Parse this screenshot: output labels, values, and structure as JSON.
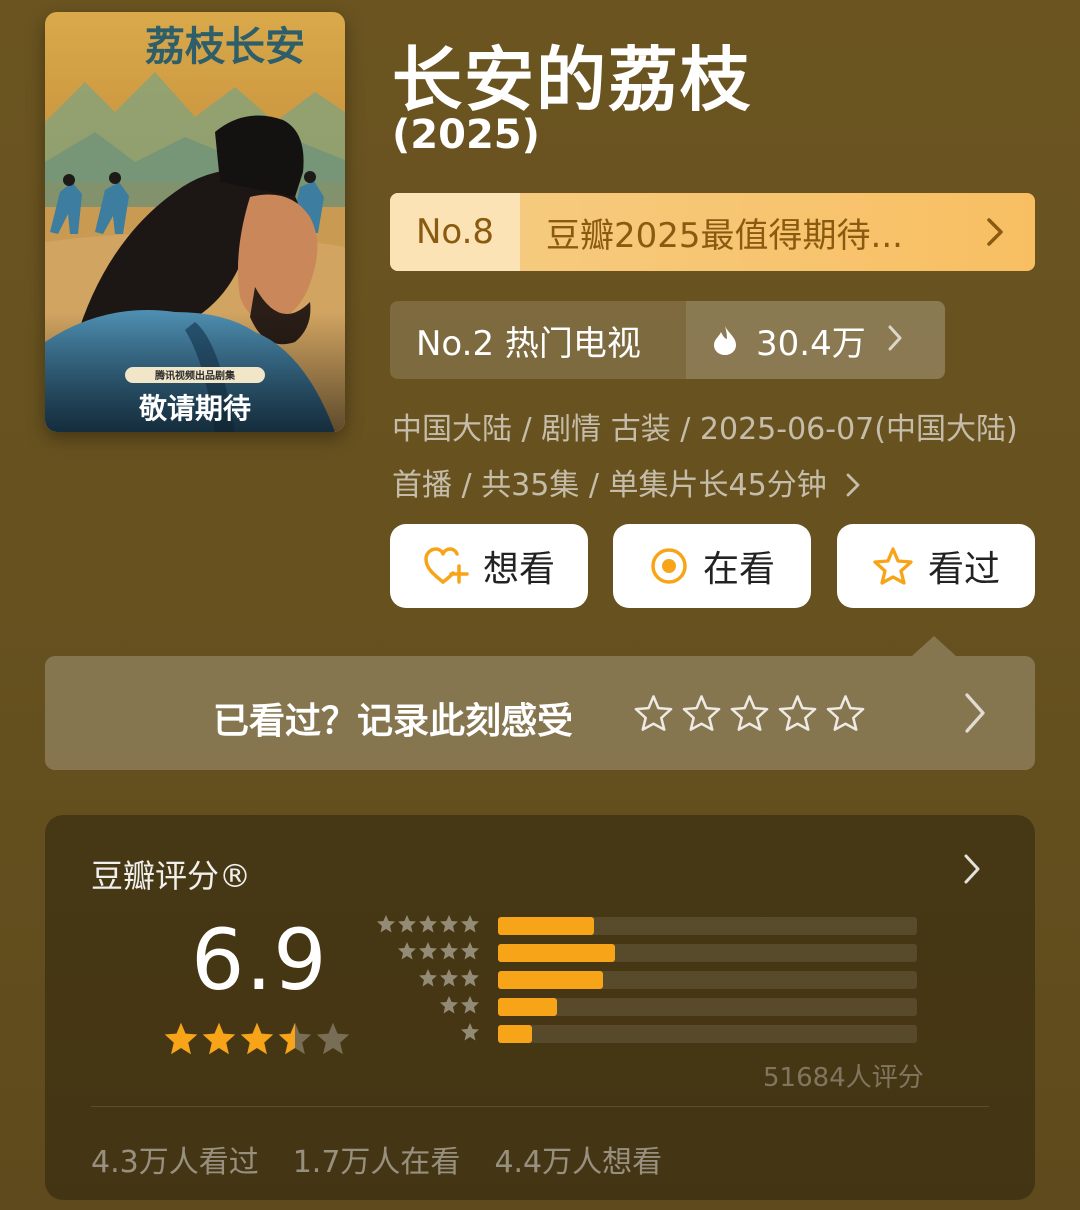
{
  "poster": {
    "title_art": "荔枝长安",
    "producer_tag": "腾讯视频出品剧集",
    "slogan": "敬请期待"
  },
  "header": {
    "title": "长安的荔枝",
    "year": "(2025)"
  },
  "rank_banner": {
    "rank": "No.8",
    "list_name": "豆瓣2025最值得期待..."
  },
  "hot_banner": {
    "rank": "No.2 热门电视",
    "count": "30.4万"
  },
  "meta": {
    "info": "中国大陆 / 剧情 古装 / 2025-06-07(中国大陆)首播 / 共35集 / 单集片长45分钟"
  },
  "actions": {
    "want": "想看",
    "watching": "在看",
    "watched": "看过"
  },
  "rate_prompt": {
    "text": "已看过？记录此刻感受"
  },
  "rating": {
    "label": "豆瓣评分®",
    "score": "6.9",
    "score_stars": 3.5,
    "distribution": [
      {
        "stars": 5,
        "fraction": 0.23
      },
      {
        "stars": 4,
        "fraction": 0.28
      },
      {
        "stars": 3,
        "fraction": 0.25
      },
      {
        "stars": 2,
        "fraction": 0.14
      },
      {
        "stars": 1,
        "fraction": 0.08
      }
    ],
    "votes": "51684人评分",
    "watched": "4.3万人看过",
    "watching": "1.7万人在看",
    "want": "4.4万人想看"
  },
  "colors": {
    "background": "#66511f",
    "accent_orange": "#f7a418",
    "rank_text": "#8a5a10"
  }
}
